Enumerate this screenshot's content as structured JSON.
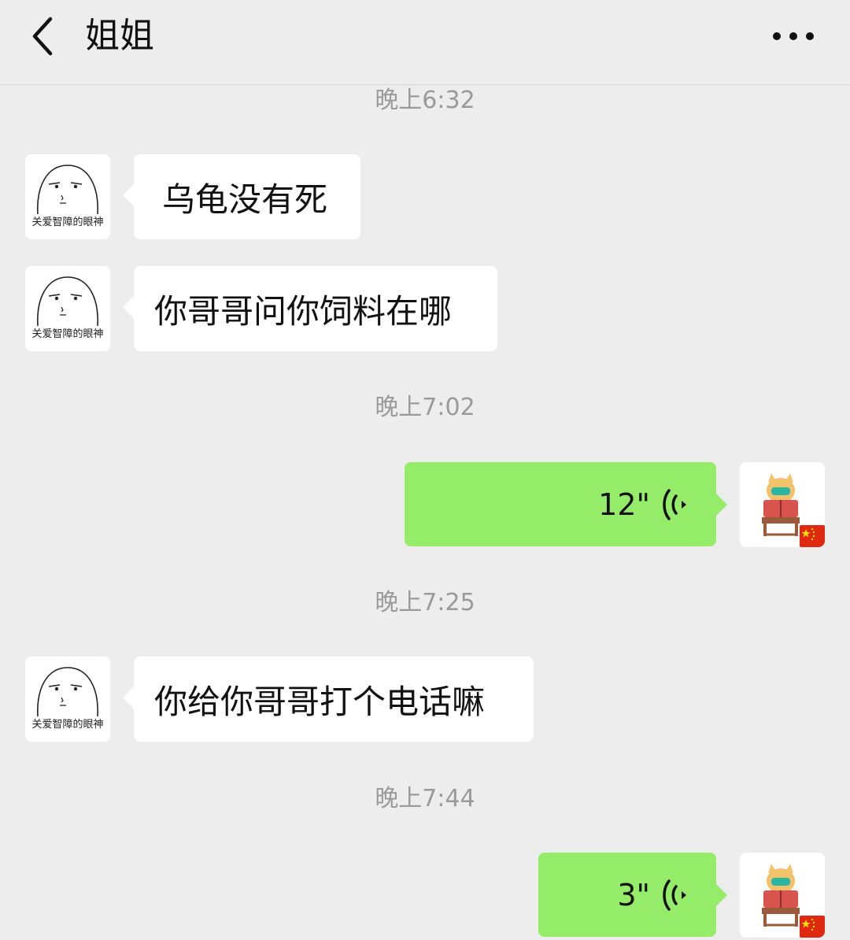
{
  "header": {
    "title": "姐姐",
    "back_icon": "chevron-left-icon",
    "more_icon": "more-dots-icon"
  },
  "messages": [
    {
      "type": "time",
      "text": "晚上6:32"
    },
    {
      "type": "text",
      "side": "left",
      "text": "乌龟没有死",
      "avatar_caption": "关爱智障的眼神"
    },
    {
      "type": "text",
      "side": "left",
      "text": "你哥哥问你饲料在哪",
      "avatar_caption": "关爱智障的眼神"
    },
    {
      "type": "time",
      "text": "晚上7:02"
    },
    {
      "type": "voice",
      "side": "right",
      "duration": "12\""
    },
    {
      "type": "time",
      "text": "晚上7:25"
    },
    {
      "type": "text",
      "side": "left",
      "text": "你给你哥哥打个电话嘛",
      "avatar_caption": "关爱智障的眼神"
    },
    {
      "type": "time",
      "text": "晚上7:44"
    },
    {
      "type": "voice",
      "side": "right",
      "duration": "3\""
    }
  ],
  "colors": {
    "background": "#ededed",
    "incoming_bubble": "#ffffff",
    "outgoing_bubble": "#95ec69",
    "timestamp": "#9a9a9a"
  }
}
